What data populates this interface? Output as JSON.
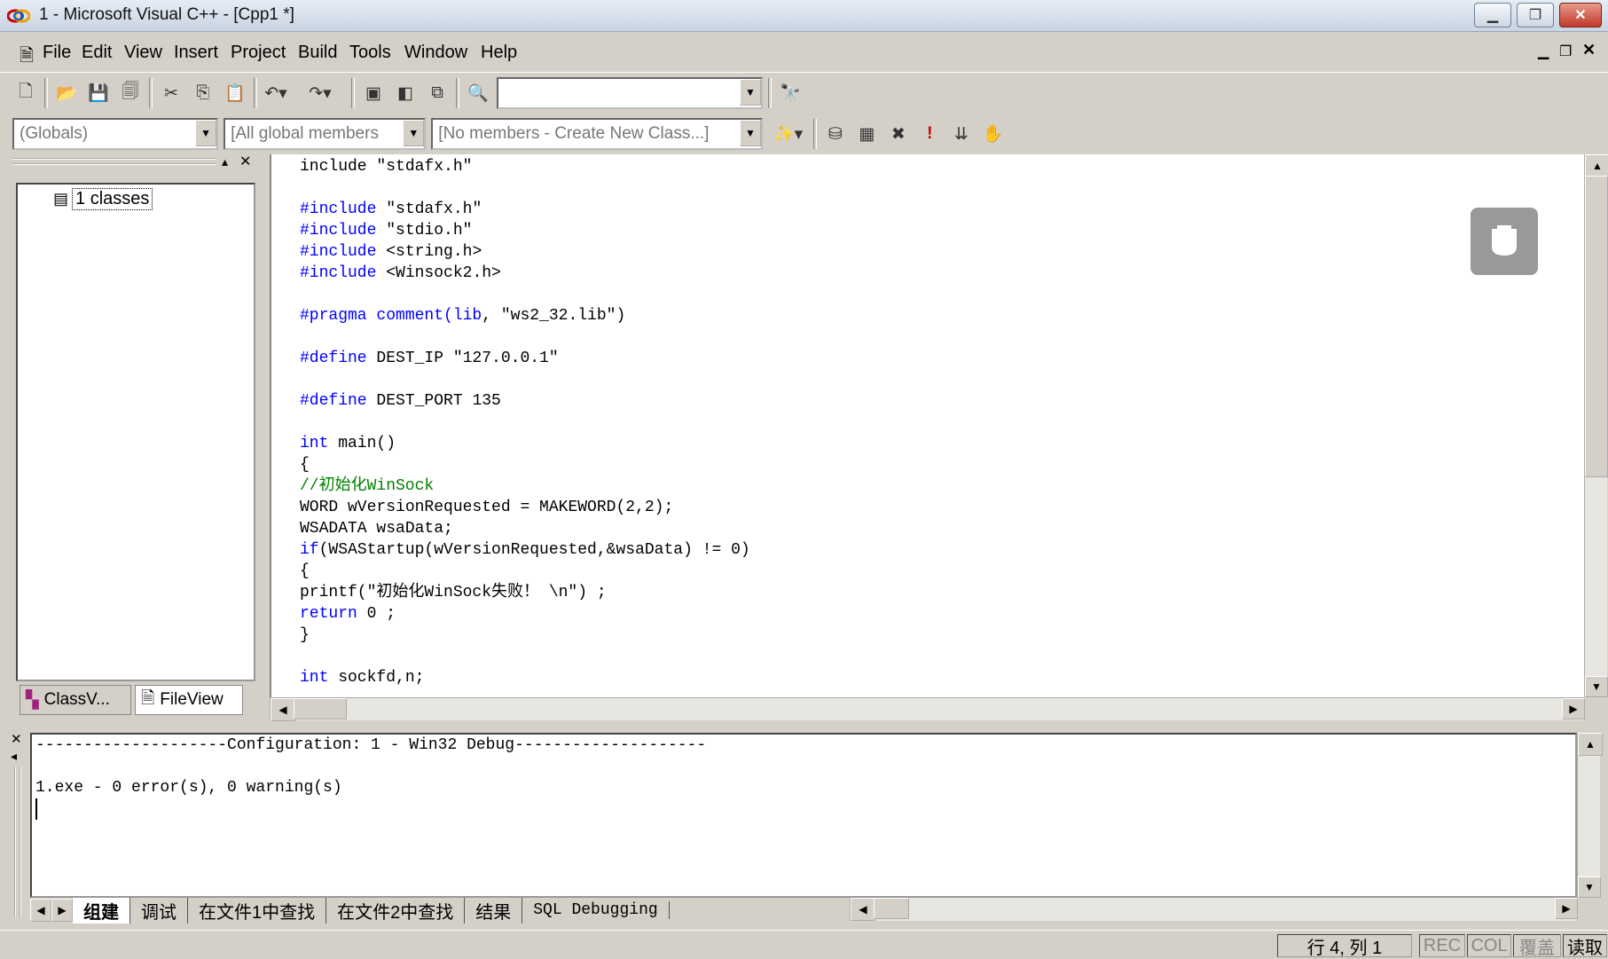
{
  "window": {
    "title": "1 - Microsoft Visual C++ - [Cpp1 *]"
  },
  "menu": [
    "File",
    "Edit",
    "View",
    "Insert",
    "Project",
    "Build",
    "Tools",
    "Window",
    "Help"
  ],
  "toolbar": {
    "find_combo_value": ""
  },
  "wizardbar": {
    "class_combo": "(Globals)",
    "filter_combo": "[All global members",
    "members_combo": "[No members - Create New Class...]"
  },
  "workspace": {
    "tree_root": "1 classes",
    "tabs": [
      "ClassV...",
      "FileView"
    ]
  },
  "editor": {
    "lines": [
      {
        "t": "include \"stdafx.h\""
      },
      {
        "t": ""
      },
      {
        "k": "#include",
        "t": " \"stdafx.h\""
      },
      {
        "k": "#include",
        "t": " \"stdio.h\""
      },
      {
        "k": "#include",
        "t": " <string.h>"
      },
      {
        "k": "#include",
        "t": " <Winsock2.h>"
      },
      {
        "t": ""
      },
      {
        "k": "#pragma comment(lib",
        "t": ", \"ws2_32.lib\")"
      },
      {
        "t": ""
      },
      {
        "k": "#define",
        "t": " DEST_IP \"127.0.0.1\""
      },
      {
        "t": ""
      },
      {
        "k": "#define",
        "t": " DEST_PORT 135"
      },
      {
        "t": ""
      },
      {
        "k": "int",
        "t": " main()"
      },
      {
        "t": "{"
      },
      {
        "c": "//初始化WinSock"
      },
      {
        "t": "WORD wVersionRequested = MAKEWORD(2,2);"
      },
      {
        "t": "WSADATA wsaData;"
      },
      {
        "k": "if",
        "t": "(WSAStartup(wVersionRequested,&wsaData) != 0)"
      },
      {
        "t": "{"
      },
      {
        "t": "printf(\"初始化WinSock失败！ \\n\") ;"
      },
      {
        "k": "return",
        "t": " 0 ;"
      },
      {
        "t": "}"
      },
      {
        "t": ""
      },
      {
        "k": "int",
        "t": " sockfd,n;"
      }
    ]
  },
  "output": {
    "lines": [
      "--------------------Configuration: 1 - Win32 Debug--------------------",
      "",
      "1.exe - 0 error(s), 0 warning(s)"
    ],
    "tabs": [
      "组建",
      "调试",
      "在文件1中查找",
      "在文件2中查找",
      "结果",
      "SQL Debugging"
    ]
  },
  "status": {
    "position": "行 4, 列 1",
    "rec": "REC",
    "col": "COL",
    "ovr": "覆盖",
    "read": "读取"
  }
}
